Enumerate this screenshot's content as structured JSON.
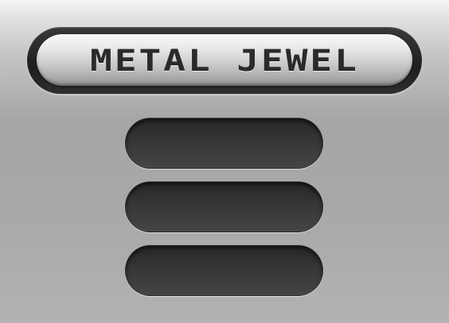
{
  "title": {
    "text": "METAL JEWEL"
  },
  "menu": {
    "buttons": [
      {
        "label": ""
      },
      {
        "label": ""
      },
      {
        "label": ""
      }
    ]
  },
  "colors": {
    "background_top": "#f6f6f6",
    "background_mid": "#a6a6a6",
    "badge_frame": "#1e1e1e",
    "plate_light": "#fafafa",
    "plate_dark": "#8c8c8c",
    "title_text": "#2a2a2a",
    "button_dark": "#262626",
    "button_light": "#444444"
  }
}
